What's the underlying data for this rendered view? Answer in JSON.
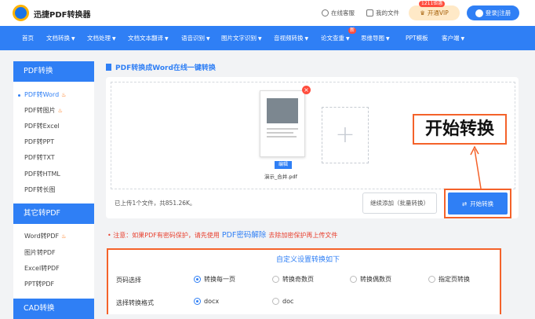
{
  "header": {
    "logo_text": "迅捷PDF转换器",
    "service_link": "在线客服",
    "files_link": "我的文件",
    "vip_badge": "1211钜惠",
    "vip_button": "开通VIP",
    "login_button": "登录|注册"
  },
  "nav": {
    "items": [
      "首页",
      "文档转换",
      "文档处理",
      "文档文本翻译",
      "语音识别",
      "图片文字识别",
      "音视频转换",
      "论文查重",
      "思维导图",
      "PPT模板",
      "客户端"
    ],
    "new_badge": "新"
  },
  "sidebar": {
    "sections": [
      {
        "title": "PDF转换",
        "items": [
          "PDF转Word",
          "PDF转图片",
          "PDF转Excel",
          "PDF转PPT",
          "PDF转TXT",
          "PDF转HTML",
          "PDF转长图"
        ]
      },
      {
        "title": "其它转PDF",
        "items": [
          "Word转PDF",
          "图片转PDF",
          "Excel转PDF",
          "PPT转PDF"
        ]
      },
      {
        "title": "CAD转换"
      }
    ]
  },
  "main": {
    "title": "PDF转换成Word在线一键转换",
    "file_name": "演示_合并.pdf",
    "edit_label": "编辑",
    "add_symbol": "+",
    "uploaded_text": "已上传1个文件，共851.26K。",
    "continue_button": "继续添加（批量转换）",
    "start_button": "开始转换",
    "annotation_label": "开始转换"
  },
  "notice": {
    "prefix": "• 注意：如果PDF有密码保护，请先使用",
    "link": "PDF密码解除",
    "suffix": "去除加密保护再上传文件"
  },
  "settings": {
    "title": "自定义设置转换如下",
    "page_label": "页码选择",
    "page_options": [
      "转换每一页",
      "转换奇数页",
      "转换偶数页",
      "指定页转换"
    ],
    "format_label": "选择转换格式",
    "format_options": [
      "docx",
      "doc"
    ]
  },
  "colors": {
    "brand_blue": "#2f7ff5",
    "highlight_orange": "#f4622a",
    "warning_red": "#e8402f"
  }
}
